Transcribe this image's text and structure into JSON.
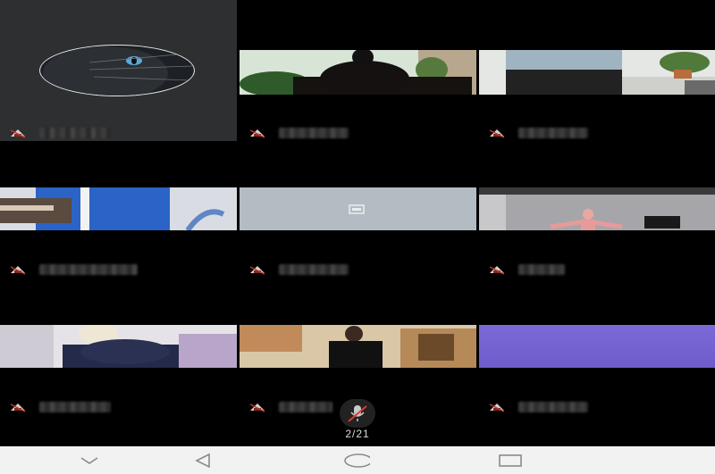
{
  "participants": [
    {
      "id": "p1",
      "name_hidden": true
    },
    {
      "id": "p2",
      "name_hidden": true
    },
    {
      "id": "p3",
      "name_hidden": true
    },
    {
      "id": "p4",
      "name_hidden": true
    },
    {
      "id": "p5",
      "name_hidden": true
    },
    {
      "id": "p6",
      "name_hidden": true
    },
    {
      "id": "p7",
      "name_hidden": true
    },
    {
      "id": "p8",
      "name_hidden": true
    },
    {
      "id": "p9",
      "name_hidden": true
    }
  ],
  "page_indicator": "2/21",
  "icons": {
    "muted_mic": "muted-microphone-icon",
    "back": "chevron-down-icon",
    "home_back": "triangle-back-icon",
    "home": "circle-home-icon",
    "recents": "square-recents-icon"
  },
  "colors": {
    "background": "#000000",
    "nav_bar": "#f2f2f2",
    "mic_muted": "#d9d0ce",
    "tile_avatar_bg": "#2d2f31",
    "tile_camera_off": "#b3bcc2",
    "tile_purple": "#7a6ad6"
  }
}
